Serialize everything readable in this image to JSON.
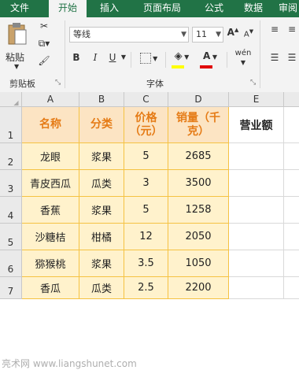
{
  "ribbon": {
    "tabs": [
      "文件",
      "开始",
      "插入",
      "页面布局",
      "公式",
      "数据",
      "审阅"
    ],
    "active_tab": "开始",
    "paste_label": "粘贴",
    "clipboard_group": "剪贴板",
    "font_group": "字体",
    "font_name": "等线",
    "font_size": "11",
    "bold": "B",
    "italic": "I",
    "underline": "U",
    "increase_font": "A",
    "decrease_font": "A",
    "font_color_letter": "A",
    "phonetic": "wén"
  },
  "columns": [
    "A",
    "B",
    "C",
    "D",
    "E"
  ],
  "rows": [
    "1",
    "2",
    "3",
    "4",
    "5",
    "6",
    "7"
  ],
  "headers": {
    "name": "名称",
    "category": "分类",
    "price": "价格（元）",
    "sales": "销量（千克）",
    "revenue": "营业额"
  },
  "data": [
    [
      "龙眼",
      "浆果",
      "5",
      "2685"
    ],
    [
      "青皮西瓜",
      "瓜类",
      "3",
      "3500"
    ],
    [
      "香蕉",
      "浆果",
      "5",
      "1258"
    ],
    [
      "沙糖桔",
      "柑橘",
      "12",
      "2050"
    ],
    [
      "猕猴桃",
      "浆果",
      "3.5",
      "1050"
    ],
    [
      "香瓜",
      "瓜类",
      "2.5",
      "2200"
    ]
  ],
  "watermark": "亮术网 www.liangshunet.com",
  "colors": {
    "ribbon_green": "#217346",
    "header_fill": "#fce4c3",
    "header_text": "#e57b16",
    "data_fill": "#fff2cc",
    "border": "#f5c242"
  }
}
